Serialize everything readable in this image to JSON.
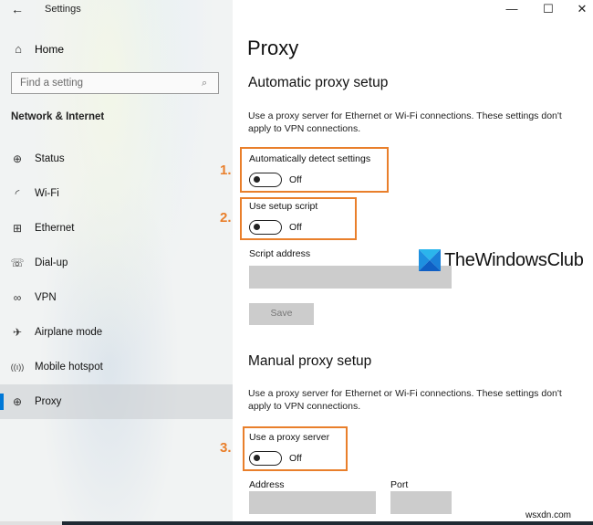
{
  "window": {
    "title": "Settings",
    "controls": {
      "minimize": "—",
      "maximize": "☐",
      "close": "✕"
    }
  },
  "sidebar": {
    "back_icon": "←",
    "home": {
      "label": "Home",
      "icon": "⌂"
    },
    "search": {
      "placeholder": "Find a setting",
      "icon": "⌕"
    },
    "section": "Network & Internet",
    "items": [
      {
        "label": "Status",
        "icon": "⊕",
        "active": false
      },
      {
        "label": "Wi-Fi",
        "icon": "◜",
        "active": false
      },
      {
        "label": "Ethernet",
        "icon": "⊞",
        "active": false
      },
      {
        "label": "Dial-up",
        "icon": "☏",
        "active": false
      },
      {
        "label": "VPN",
        "icon": "∞",
        "active": false
      },
      {
        "label": "Airplane mode",
        "icon": "✈",
        "active": false
      },
      {
        "label": "Mobile hotspot",
        "icon": "((ı))",
        "active": false
      },
      {
        "label": "Proxy",
        "icon": "⊕",
        "active": true
      }
    ]
  },
  "main": {
    "title": "Proxy",
    "automatic": {
      "heading": "Automatic proxy setup",
      "description": "Use a proxy server for Ethernet or Wi-Fi connections. These settings don't apply to VPN connections.",
      "detect": {
        "label": "Automatically detect settings",
        "state": "Off"
      },
      "script": {
        "label": "Use setup script",
        "state": "Off"
      },
      "script_address": {
        "label": "Script address",
        "value": ""
      },
      "save_label": "Save"
    },
    "manual": {
      "heading": "Manual proxy setup",
      "description": "Use a proxy server for Ethernet or Wi-Fi connections. These settings don't apply to VPN connections.",
      "use_proxy": {
        "label": "Use a proxy server",
        "state": "Off"
      },
      "address": {
        "label": "Address",
        "value": ""
      },
      "port": {
        "label": "Port",
        "value": ""
      }
    }
  },
  "annotations": {
    "color": "#e97f2b",
    "numbers": [
      "1.",
      "2.",
      "3."
    ]
  },
  "watermark": {
    "text": "TheWindowsClub",
    "site": "wsxdn.com"
  }
}
